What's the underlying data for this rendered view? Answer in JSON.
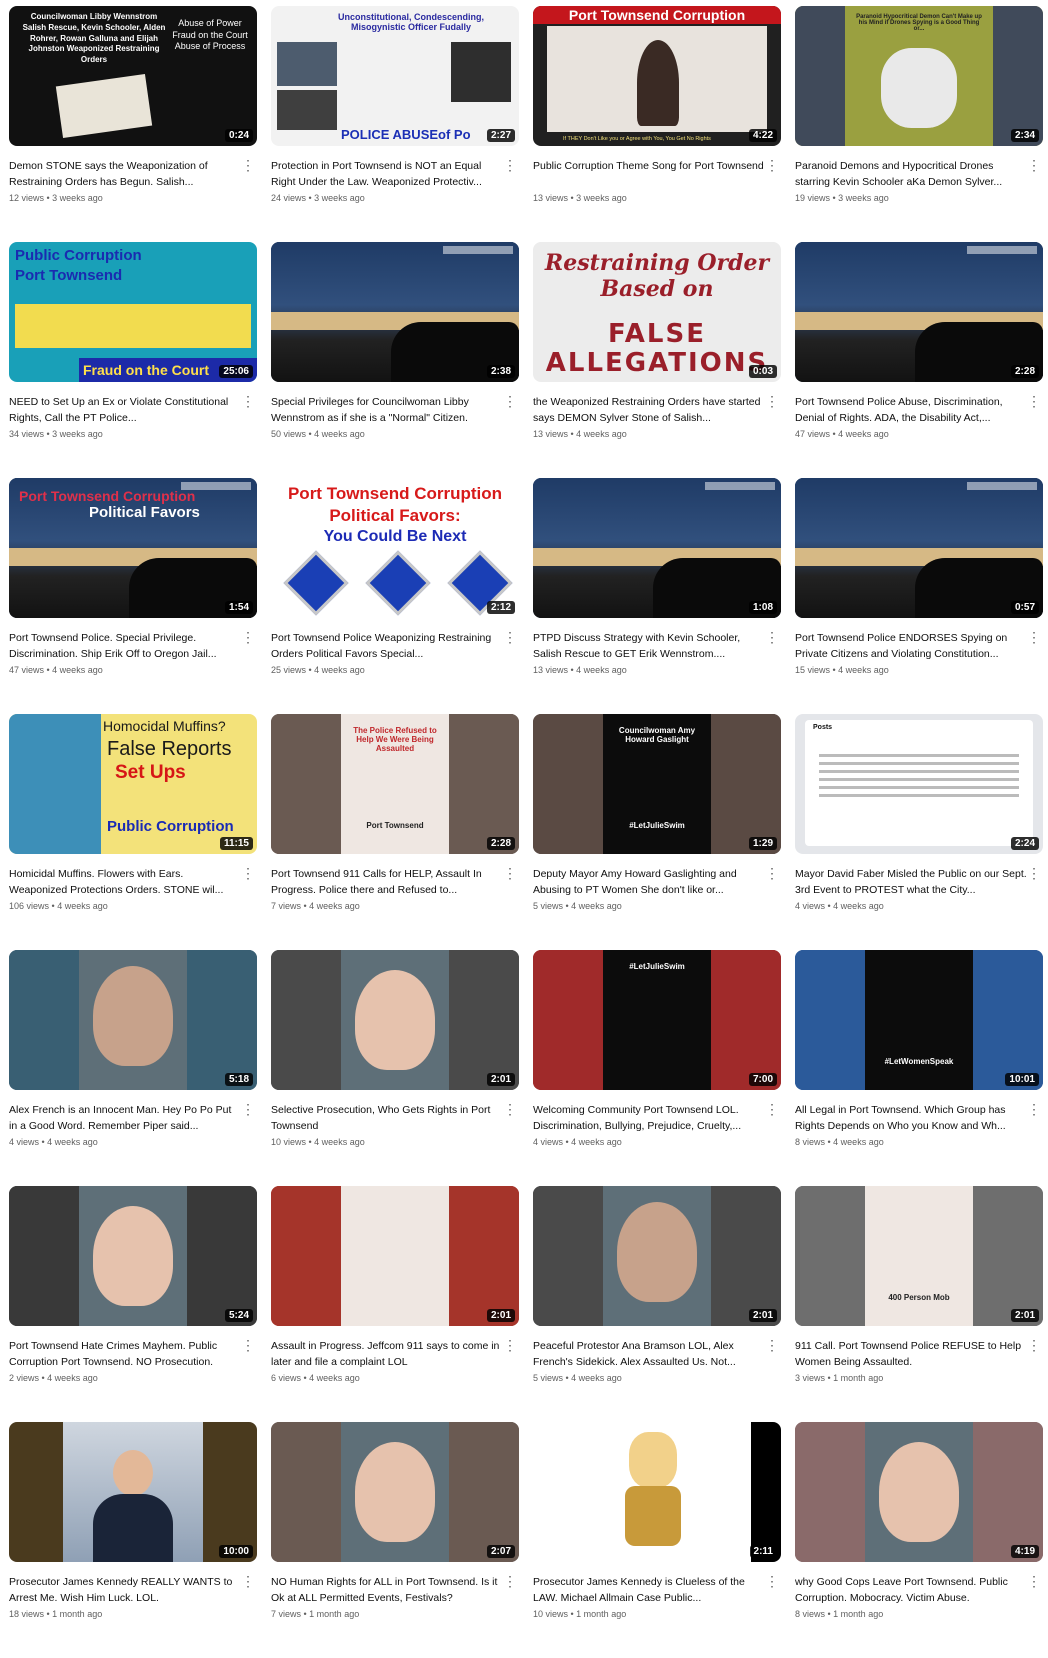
{
  "videos": [
    {
      "title": "Demon STONE says the Weaponization of Restraining Orders has Begun. Salish...",
      "views": "12 views",
      "age": "3 weeks ago",
      "duration": "0:24",
      "overlay": "Councilwoman Libby Wennstrom Salish Rescue, Kevin Schooler, Alden Rohrer, Rowan Galluna and Elijah Johnston Weaponized Restraining Orders",
      "overlay2": "Abuse of Power Fraud on the Court Abuse of Process"
    },
    {
      "title": "Protection in Port Townsend is NOT an Equal Right Under the Law. Weaponized Protectiv...",
      "views": "24 views",
      "age": "3 weeks ago",
      "duration": "2:27",
      "overlay": "Unconstitutional, Condescending, Misogynistic Officer Fudally",
      "overlay2": "POLICE ABUSEof Po"
    },
    {
      "title": "Public Corruption Theme Song for Port Townsend",
      "views": "13 views",
      "age": "3 weeks ago",
      "duration": "4:22",
      "overlay": "Port Townsend Corruption",
      "overlay2": "If THEY Don't Like you or Agree with You, You Get No Rights"
    },
    {
      "title": "Paranoid Demons and Hypocritical Drones starring Kevin Schooler aKa Demon Sylver...",
      "views": "19 views",
      "age": "3 weeks ago",
      "duration": "2:34",
      "overlay": "Paranoid Hypocritical Demon Can't Make up his Mind if Drones Spying is a Good Thing or...",
      "overlay2": ""
    },
    {
      "title": "NEED to Set Up an Ex or Violate Constitutional Rights, Call the PT Police...",
      "views": "34 views",
      "age": "3 weeks ago",
      "duration": "25:06",
      "overlay": "Public Corruption Port Townsend",
      "overlay2": "Fraud on the Court"
    },
    {
      "title": "Special Privileges for Councilwoman Libby Wennstrom as if she is a \"Normal\" Citizen.",
      "views": "50 views",
      "age": "4 weeks ago",
      "duration": "2:38",
      "overlay": "",
      "overlay2": ""
    },
    {
      "title": "the Weaponized Restraining Orders have started says DEMON Sylver Stone of Salish...",
      "views": "13 views",
      "age": "4 weeks ago",
      "duration": "0:03",
      "overlay": "Restraining Order Based on",
      "overlay2": "FALSE ALLEGATIONS"
    },
    {
      "title": "Port Townsend Police Abuse, Discrimination, Denial of Rights. ADA, the Disability Act,...",
      "views": "47 views",
      "age": "4 weeks ago",
      "duration": "2:28",
      "overlay": "",
      "overlay2": ""
    },
    {
      "title": "Port Townsend Police. Special Privilege. Discrimination. Ship Erik Off to Oregon Jail...",
      "views": "47 views",
      "age": "4 weeks ago",
      "duration": "1:54",
      "overlay": "Port Townsend Corruption",
      "overlay2": "Political Favors"
    },
    {
      "title": "Port Townsend Police Weaponizing Restraining Orders Political Favors Special...",
      "views": "25 views",
      "age": "4 weeks ago",
      "duration": "2:12",
      "overlay": "Port Townsend Corruption",
      "overlay2": "Political Favors:",
      "overlay3": "You Could Be Next"
    },
    {
      "title": "PTPD Discuss Strategy with Kevin Schooler, Salish Rescue to GET Erik Wennstrom....",
      "views": "13 views",
      "age": "4 weeks ago",
      "duration": "1:08",
      "overlay": "",
      "overlay2": ""
    },
    {
      "title": "Port Townsend Police ENDORSES Spying on Private Citizens and Violating Constitution...",
      "views": "15 views",
      "age": "4 weeks ago",
      "duration": "0:57",
      "overlay": "",
      "overlay2": ""
    },
    {
      "title": "Homicidal Muffins. Flowers with Ears. Weaponized Protections Orders. STONE wil...",
      "views": "106 views",
      "age": "4 weeks ago",
      "duration": "11:15",
      "overlay": "Homocidal Muffins?",
      "overlay2": "False Reports",
      "overlay3": "Set Ups",
      "overlay4": "Public Corruption"
    },
    {
      "title": "Port Townsend 911 Calls for HELP, Assault In Progress. Police there and Refused to...",
      "views": "7 views",
      "age": "4 weeks ago",
      "duration": "2:28",
      "overlay": "The Police Refused to Help We Were Being Assaulted",
      "overlay2": "Port Townsend"
    },
    {
      "title": "Deputy Mayor Amy Howard Gaslighting and Abusing to PT Women She don't like or...",
      "views": "5 views",
      "age": "4 weeks ago",
      "duration": "1:29",
      "overlay": "Councilwoman Amy Howard Gaslight",
      "overlay2": "#LetJulieSwim"
    },
    {
      "title": "Mayor David Faber Misled the Public on our Sept. 3rd Event to PROTEST what the City...",
      "views": "4 views",
      "age": "4 weeks ago",
      "duration": "2:24",
      "overlay": "Posts",
      "overlay2": ""
    },
    {
      "title": "Alex French is an Innocent Man. Hey Po Po Put in a Good Word. Remember Piper said...",
      "views": "4 views",
      "age": "4 weeks ago",
      "duration": "5:18",
      "overlay": "",
      "overlay2": ""
    },
    {
      "title": "Selective Prosecution, Who Gets Rights in Port Townsend",
      "views": "10 views",
      "age": "4 weeks ago",
      "duration": "2:01",
      "overlay": "",
      "overlay2": ""
    },
    {
      "title": "Welcoming Community Port Townsend LOL. Discrimination, Bullying, Prejudice, Cruelty,...",
      "views": "4 views",
      "age": "4 weeks ago",
      "duration": "7:00",
      "overlay": "#LetJulieSwim",
      "overlay2": ""
    },
    {
      "title": "All Legal in Port Townsend. Which Group has Rights Depends on Who you Know and Wh...",
      "views": "8 views",
      "age": "4 weeks ago",
      "duration": "10:01",
      "overlay": "",
      "overlay2": "#LetWomenSpeak"
    },
    {
      "title": "Port Townsend Hate Crimes Mayhem. Public Corruption Port Townsend. NO Prosecution.",
      "views": "2 views",
      "age": "4 weeks ago",
      "duration": "5:24",
      "overlay": "",
      "overlay2": ""
    },
    {
      "title": "Assault in Progress. Jeffcom 911 says to come in later and file a complaint LOL",
      "views": "6 views",
      "age": "4 weeks ago",
      "duration": "2:01",
      "overlay": "",
      "overlay2": ""
    },
    {
      "title": "Peaceful Protestor Ana Bramson LOL, Alex French's Sidekick. Alex Assaulted Us. Not...",
      "views": "5 views",
      "age": "4 weeks ago",
      "duration": "2:01",
      "overlay": "",
      "overlay2": ""
    },
    {
      "title": "911 Call. Port Townsend Police REFUSE to Help Women Being Assaulted.",
      "views": "3 views",
      "age": "1 month ago",
      "duration": "2:01",
      "overlay": "",
      "overlay2": "400 Person Mob"
    },
    {
      "title": "Prosecutor James Kennedy REALLY WANTS to Arrest Me. Wish Him Luck. LOL.",
      "views": "18 views",
      "age": "1 month ago",
      "duration": "10:00",
      "overlay": "",
      "overlay2": ""
    },
    {
      "title": "NO Human Rights for ALL in Port Townsend. Is it Ok at ALL Permitted Events, Festivals?",
      "views": "7 views",
      "age": "1 month ago",
      "duration": "2:07",
      "overlay": "",
      "overlay2": ""
    },
    {
      "title": "Prosecutor James Kennedy is Clueless of the LAW. Michael Allmain Case Public...",
      "views": "10 views",
      "age": "1 month ago",
      "duration": "2:11",
      "overlay": "",
      "overlay2": ""
    },
    {
      "title": "why Good Cops Leave Port Townsend. Public Corruption. Mobocracy. Victim Abuse.",
      "views": "8 views",
      "age": "1 month ago",
      "duration": "4:19",
      "overlay": "",
      "overlay2": ""
    }
  ],
  "icons": {
    "more": "vertical-ellipsis-icon"
  },
  "colors": {
    "badge_bg": "#000000",
    "meta_text": "#606060",
    "title_text": "#0f0f0f"
  }
}
